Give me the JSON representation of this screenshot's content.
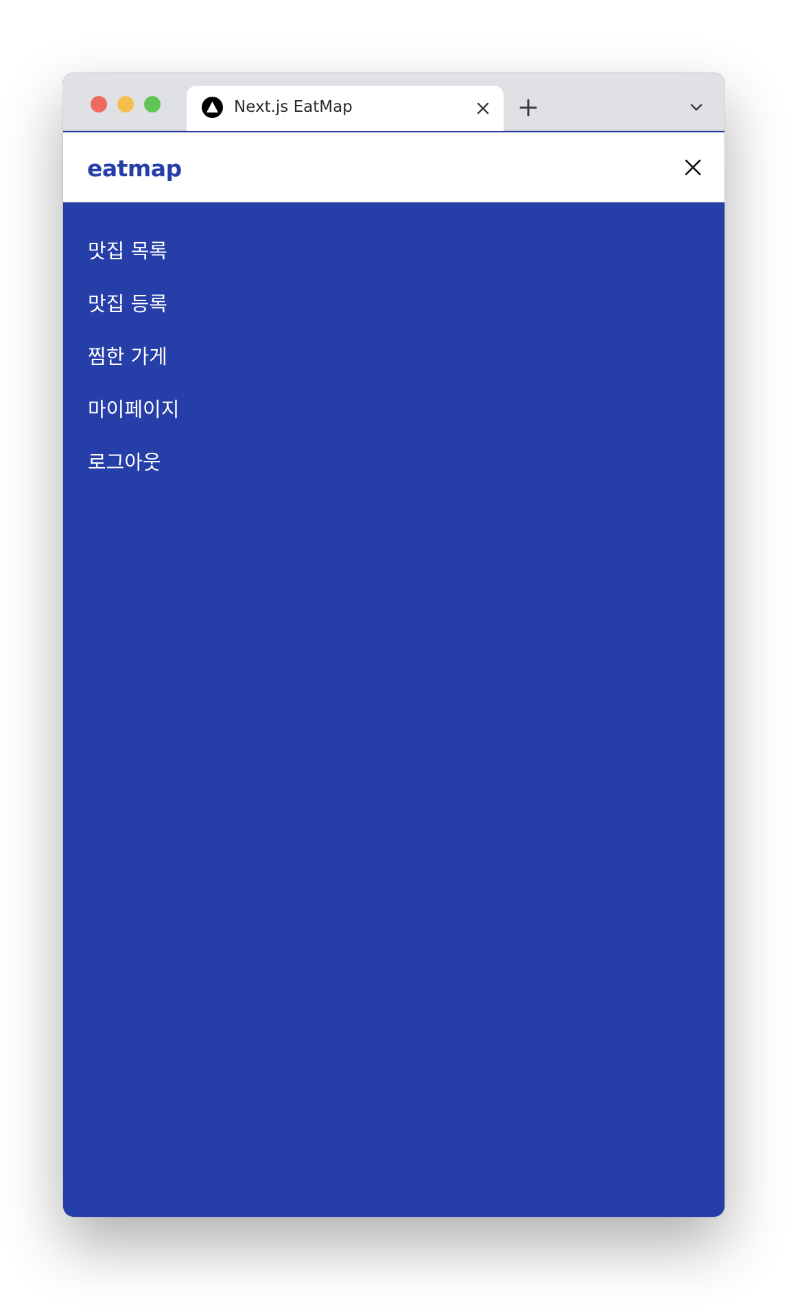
{
  "browser": {
    "tab": {
      "title": "Next.js EatMap",
      "favicon": "nextjs-triangle-icon"
    },
    "controls": {
      "close_tab_icon": "close-icon",
      "new_tab_icon": "plus-icon",
      "tab_list_icon": "chevron-down-icon"
    },
    "traffic_lights": [
      "#ee6a5f",
      "#f5be4f",
      "#61c454"
    ]
  },
  "header": {
    "brand": "eatmap",
    "close_icon": "close-icon"
  },
  "menu": {
    "items": [
      {
        "label": "맛집 목록"
      },
      {
        "label": "맛집 등록"
      },
      {
        "label": "찜한 가게"
      },
      {
        "label": "마이페이지"
      },
      {
        "label": "로그아웃"
      }
    ]
  },
  "colors": {
    "brand": "#263ea8",
    "menu_background": "#263ea8",
    "menu_text": "#ffffff"
  }
}
